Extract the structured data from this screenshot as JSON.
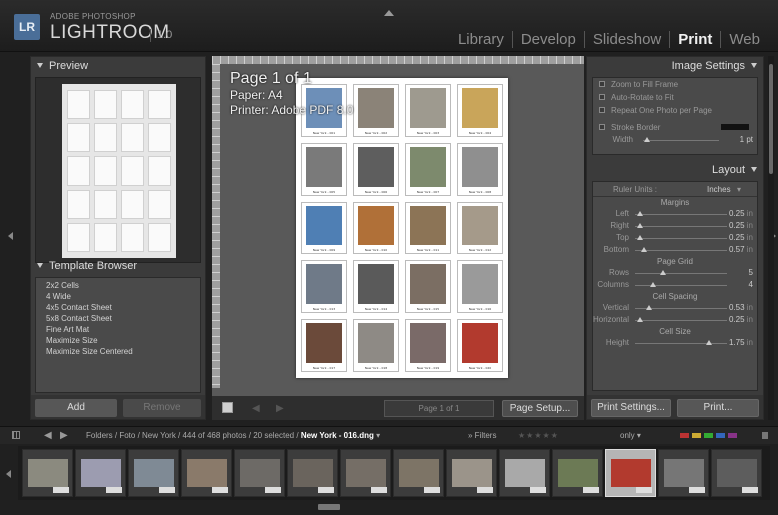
{
  "app": {
    "logo": "LR",
    "brand_sup": "ADOBE PHOTOSHOP",
    "brand_main": "LIGHTROOM",
    "version": "1.0",
    "modules": [
      "Library",
      "Develop",
      "Slideshow",
      "Print",
      "Web"
    ],
    "active_module": "Print"
  },
  "left_panel": {
    "preview_title": "Preview",
    "template_browser_title": "Template Browser",
    "templates": [
      "2x2 Cells",
      "4 Wide",
      "4x5 Contact Sheet",
      "5x8 Contact Sheet",
      "Fine Art Mat",
      "Maximize Size",
      "Maximize Size Centered"
    ],
    "add_label": "Add",
    "remove_label": "Remove"
  },
  "center": {
    "page_info": "Page 1 of 1",
    "paper": "Paper:  A4",
    "printer": "Printer:  Adobe PDF 8.0",
    "page_box": "Page 1 of 1",
    "page_setup_label": "Page Setup...",
    "thumbs": [
      {
        "color": "#6d8fb8",
        "caption": "New York - 001"
      },
      {
        "color": "#8b8378",
        "caption": "New York - 002"
      },
      {
        "color": "#9e9a8f",
        "caption": "New York - 003"
      },
      {
        "color": "#c9a55a",
        "caption": "New York - 004"
      },
      {
        "color": "#7a7a7a",
        "caption": "New York - 005"
      },
      {
        "color": "#5e5e5e",
        "caption": "New York - 006"
      },
      {
        "color": "#7d8a6d",
        "caption": "New York - 007"
      },
      {
        "color": "#8f8f8f",
        "caption": "New York - 008"
      },
      {
        "color": "#4f7fb4",
        "caption": "New York - 009"
      },
      {
        "color": "#b07038",
        "caption": "New York - 010"
      },
      {
        "color": "#8c7456",
        "caption": "New York - 011"
      },
      {
        "color": "#a59a8a",
        "caption": "New York - 012"
      },
      {
        "color": "#6f7a88",
        "caption": "New York - 013"
      },
      {
        "color": "#5a5a5a",
        "caption": "New York - 014"
      },
      {
        "color": "#7b6e63",
        "caption": "New York - 015"
      },
      {
        "color": "#9a9a9a",
        "caption": "New York - 016"
      },
      {
        "color": "#6b4a3a",
        "caption": "New York - 017"
      },
      {
        "color": "#8e8a85",
        "caption": "New York - 018"
      },
      {
        "color": "#7a6a68",
        "caption": "New York - 019"
      },
      {
        "color": "#b23a2e",
        "caption": "New York - 020"
      }
    ]
  },
  "right_panel": {
    "image_settings_title": "Image Settings",
    "options": [
      "Zoom to Fill Frame",
      "Auto-Rotate to Fit",
      "Repeat One Photo per Page",
      "Stroke Border"
    ],
    "width_label": "Width",
    "width_value": "1 pt",
    "width_level": 0.05,
    "layout_title": "Layout",
    "ruler_units_label": "Ruler Units :",
    "ruler_units_value": "Inches",
    "margins_title": "Margins",
    "margins": [
      {
        "label": "Left",
        "value": "0.25",
        "unit": "in",
        "level": 0.05
      },
      {
        "label": "Right",
        "value": "0.25",
        "unit": "in",
        "level": 0.05
      },
      {
        "label": "Top",
        "value": "0.25",
        "unit": "in",
        "level": 0.05
      },
      {
        "label": "Bottom",
        "value": "0.57",
        "unit": "in",
        "level": 0.1
      }
    ],
    "page_grid_title": "Page Grid",
    "grid": [
      {
        "label": "Rows",
        "value": "5",
        "unit": "",
        "level": 0.3
      },
      {
        "label": "Columns",
        "value": "4",
        "unit": "",
        "level": 0.2
      }
    ],
    "cell_spacing_title": "Cell Spacing",
    "spacing": [
      {
        "label": "Vertical",
        "value": "0.53",
        "unit": "in",
        "level": 0.15
      },
      {
        "label": "Horizontal",
        "value": "0.25",
        "unit": "in",
        "level": 0.05
      }
    ],
    "cell_size_title": "Cell Size",
    "size": [
      {
        "label": "Height",
        "value": "1.75",
        "unit": "in",
        "level": 0.8
      }
    ],
    "print_settings_label": "Print Settings...",
    "print_label": "Print..."
  },
  "filmstrip": {
    "path": "Folders / Foto / New York / 444 of 468 photos / 20 selected /",
    "file": "New York - 016.dng",
    "filters_label": "Filters",
    "only_label": "only",
    "flag_colors": [
      "#b33",
      "#ca3",
      "#3a3",
      "#36b",
      "#838"
    ],
    "thumbs": [
      {
        "color": "#8b8a7f"
      },
      {
        "color": "#9c9cb0"
      },
      {
        "color": "#7f8a95"
      },
      {
        "color": "#8a7a6a"
      },
      {
        "color": "#6d6a66"
      },
      {
        "color": "#6a645d"
      },
      {
        "color": "#756e66"
      },
      {
        "color": "#7d7466"
      },
      {
        "color": "#9b948a"
      },
      {
        "color": "#a9a9a9"
      },
      {
        "color": "#6c7a55"
      },
      {
        "color": "#b23a2e"
      },
      {
        "color": "#767676"
      },
      {
        "color": "#5d5d5d"
      }
    ],
    "selected_index": 11
  }
}
